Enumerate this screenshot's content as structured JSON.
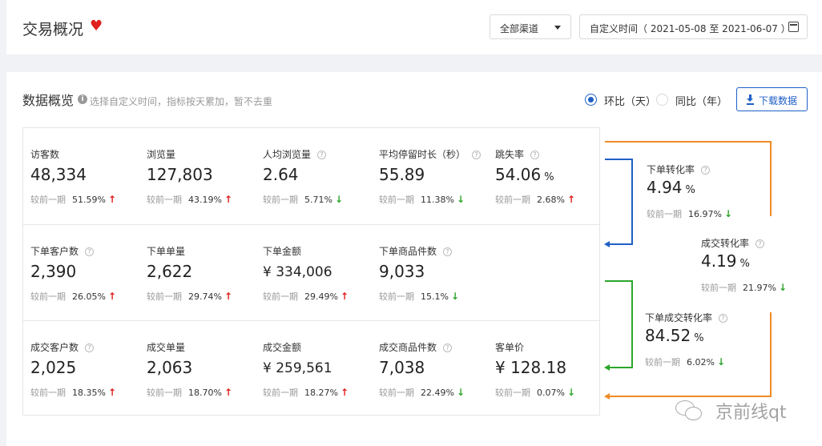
{
  "header": {
    "title": "交易概况",
    "channel": "全部渠道",
    "date_range": "自定义时间（ 2021-05-08 至 2021-06-07 ）"
  },
  "overview": {
    "title": "数据概览",
    "hint": "选择自定义时间，指标按天累加，暂不去重",
    "radio_day": "环比（天）",
    "radio_year": "同比（年）",
    "download_label": "下载数据",
    "compare_label": "较前一期"
  },
  "rows": [
    [
      {
        "label": "访客数",
        "help": false,
        "value": "48,334",
        "unit": "",
        "pct": "51.59%",
        "trend": "up"
      },
      {
        "label": "浏览量",
        "help": false,
        "value": "127,803",
        "unit": "",
        "pct": "43.19%",
        "trend": "up"
      },
      {
        "label": "人均浏览量",
        "help": true,
        "value": "2.64",
        "unit": "",
        "pct": "5.71%",
        "trend": "down"
      },
      {
        "label": "平均停留时长（秒）",
        "help": true,
        "value": "55.89",
        "unit": "",
        "pct": "11.38%",
        "trend": "down"
      },
      {
        "label": "跳失率",
        "help": true,
        "value": "54.06",
        "unit": "%",
        "pct": "2.68%",
        "trend": "up"
      }
    ],
    [
      {
        "label": "下单客户数",
        "help": true,
        "value": "2,390",
        "unit": "",
        "pct": "26.05%",
        "trend": "up"
      },
      {
        "label": "下单单量",
        "help": false,
        "value": "2,622",
        "unit": "",
        "pct": "29.74%",
        "trend": "up"
      },
      {
        "label": "下单金额",
        "help": false,
        "value": "¥ 334,006",
        "unit": "",
        "pct": "29.49%",
        "trend": "up",
        "money": true
      },
      {
        "label": "下单商品件数",
        "help": true,
        "value": "9,033",
        "unit": "",
        "pct": "15.1%",
        "trend": "down"
      }
    ],
    [
      {
        "label": "成交客户数",
        "help": true,
        "value": "2,025",
        "unit": "",
        "pct": "18.35%",
        "trend": "up"
      },
      {
        "label": "成交单量",
        "help": false,
        "value": "2,063",
        "unit": "",
        "pct": "18.70%",
        "trend": "up"
      },
      {
        "label": "成交金额",
        "help": false,
        "value": "¥ 259,561",
        "unit": "",
        "pct": "18.27%",
        "trend": "up",
        "money": true
      },
      {
        "label": "成交商品件数",
        "help": true,
        "value": "7,038",
        "unit": "",
        "pct": "22.49%",
        "trend": "down"
      },
      {
        "label": "客单价",
        "help": false,
        "value": "¥ 128.18",
        "unit": "",
        "pct": "0.07%",
        "trend": "down"
      }
    ]
  ],
  "conversions": [
    {
      "label": "下单转化率",
      "value": "4.94",
      "unit": "%",
      "pct": "16.97%",
      "trend": "down"
    },
    {
      "label": "成交转化率",
      "value": "4.19",
      "unit": "%",
      "pct": "21.97%",
      "trend": "down"
    },
    {
      "label": "下单成交转化率",
      "value": "84.52",
      "unit": "%",
      "pct": "6.02%",
      "trend": "down"
    }
  ],
  "watermark": "京前线qt",
  "colors": {
    "accent": "#1f5fc7",
    "up": "#e0201c",
    "down": "#2ca52c",
    "orange": "#f08a24",
    "green": "#2ca52c",
    "blue": "#1f5fc7"
  }
}
